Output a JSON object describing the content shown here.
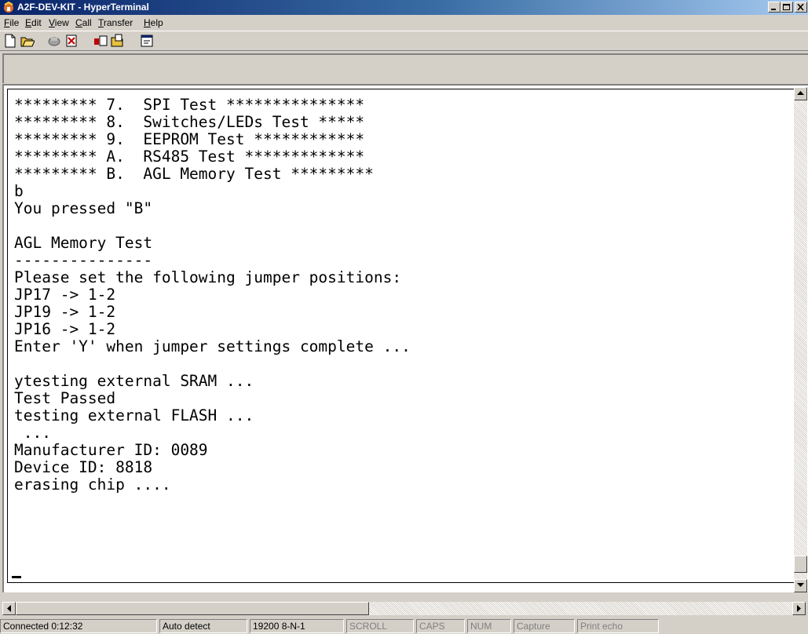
{
  "window": {
    "title": "A2F-DEV-KIT - HyperTerminal"
  },
  "menu": [
    {
      "underline": "F",
      "rest": "ile"
    },
    {
      "underline": "E",
      "rest": "dit"
    },
    {
      "underline": "V",
      "rest": "iew"
    },
    {
      "underline": "C",
      "rest": "all"
    },
    {
      "underline": "T",
      "rest": "ransfer"
    },
    {
      "underline": "H",
      "rest": "elp"
    }
  ],
  "toolbar": {
    "icons": [
      "new-icon",
      "open-icon",
      "phone-disconnect-icon",
      "disconnect-icon",
      "send-icon",
      "receive-icon",
      "properties-icon"
    ]
  },
  "terminal": {
    "lines": [
      "********* 7.  SPI Test ***************",
      "********* 8.  Switches/LEDs Test *****",
      "********* 9.  EEPROM Test ************",
      "********* A.  RS485 Test *************",
      "********* B.  AGL Memory Test *********",
      "b",
      "You pressed \"B\"",
      "",
      "AGL Memory Test",
      "---------------",
      "Please set the following jumper positions:",
      "JP17 -> 1-2",
      "JP19 -> 1-2",
      "JP16 -> 1-2",
      "Enter 'Y' when jumper settings complete ...",
      "",
      "ytesting external SRAM ...",
      "Test Passed",
      "testing external FLASH ...",
      " ...",
      "Manufacturer ID: 0089",
      "Device ID: 8818",
      "erasing chip ...."
    ]
  },
  "status": {
    "connection": "Connected 0:12:32",
    "detect": "Auto detect",
    "settings": "19200 8-N-1",
    "scroll": "SCROLL",
    "caps": "CAPS",
    "num": "NUM",
    "capture": "Capture",
    "print_echo": "Print echo"
  }
}
